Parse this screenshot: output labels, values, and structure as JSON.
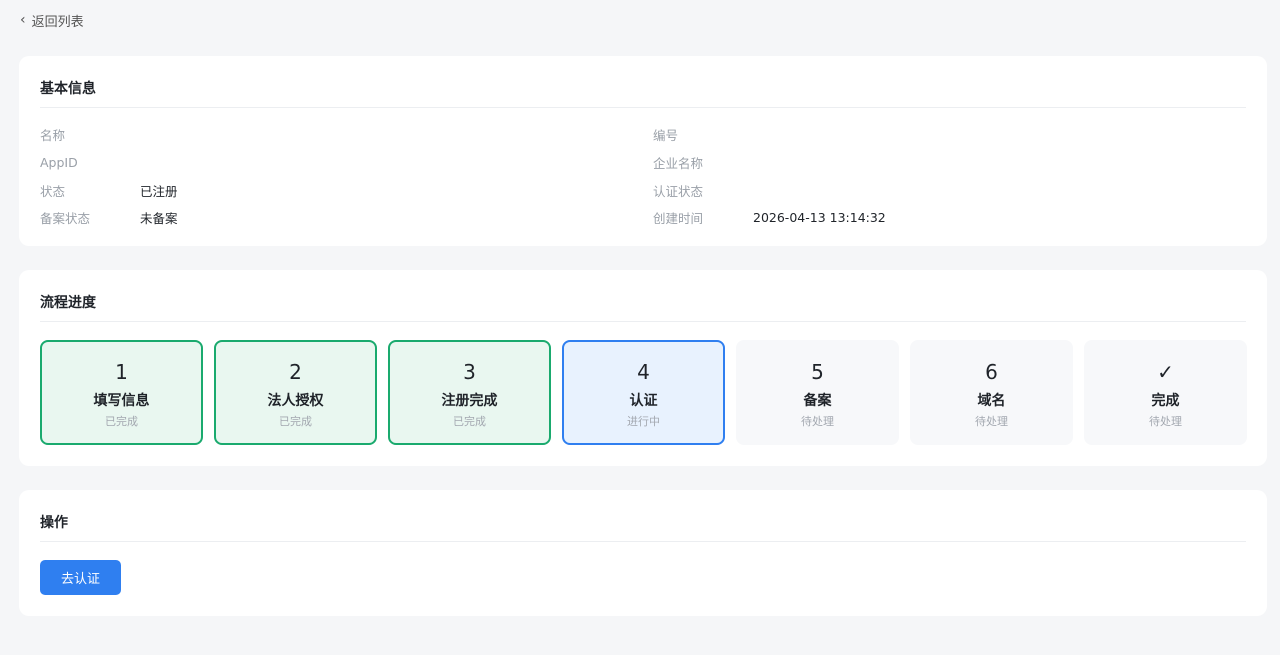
{
  "back": {
    "label": "返回列表"
  },
  "info": {
    "title": "基本信息",
    "left": [
      {
        "label": "名称",
        "value": ""
      },
      {
        "label": "AppID",
        "value": ""
      },
      {
        "label": "状态",
        "value": "已注册"
      },
      {
        "label": "备案状态",
        "value": "未备案"
      }
    ],
    "right": [
      {
        "label": "编号",
        "value": ""
      },
      {
        "label": "企业名称",
        "value": ""
      },
      {
        "label": "认证状态",
        "value": ""
      },
      {
        "label": "创建时间",
        "value": "2026-04-13 13:14:32"
      }
    ]
  },
  "steps": {
    "title": "流程进度",
    "items": [
      {
        "num": "1",
        "name": "填写信息",
        "status": "已完成",
        "state": "done"
      },
      {
        "num": "2",
        "name": "法人授权",
        "status": "已完成",
        "state": "done"
      },
      {
        "num": "3",
        "name": "注册完成",
        "status": "已完成",
        "state": "done"
      },
      {
        "num": "4",
        "name": "认证",
        "status": "进行中",
        "state": "active"
      },
      {
        "num": "5",
        "name": "备案",
        "status": "待处理",
        "state": "pending"
      },
      {
        "num": "6",
        "name": "域名",
        "status": "待处理",
        "state": "pending"
      },
      {
        "num": "✓",
        "name": "完成",
        "status": "待处理",
        "state": "pending"
      }
    ]
  },
  "actions": {
    "title": "操作",
    "primary_label": "去认证"
  },
  "colors": {
    "done_border": "#1aaa6e",
    "done_bg": "#e9f7f0",
    "active_border": "#2f7ff0",
    "active_bg": "#e8f2fe",
    "primary": "#2f7ff0"
  }
}
